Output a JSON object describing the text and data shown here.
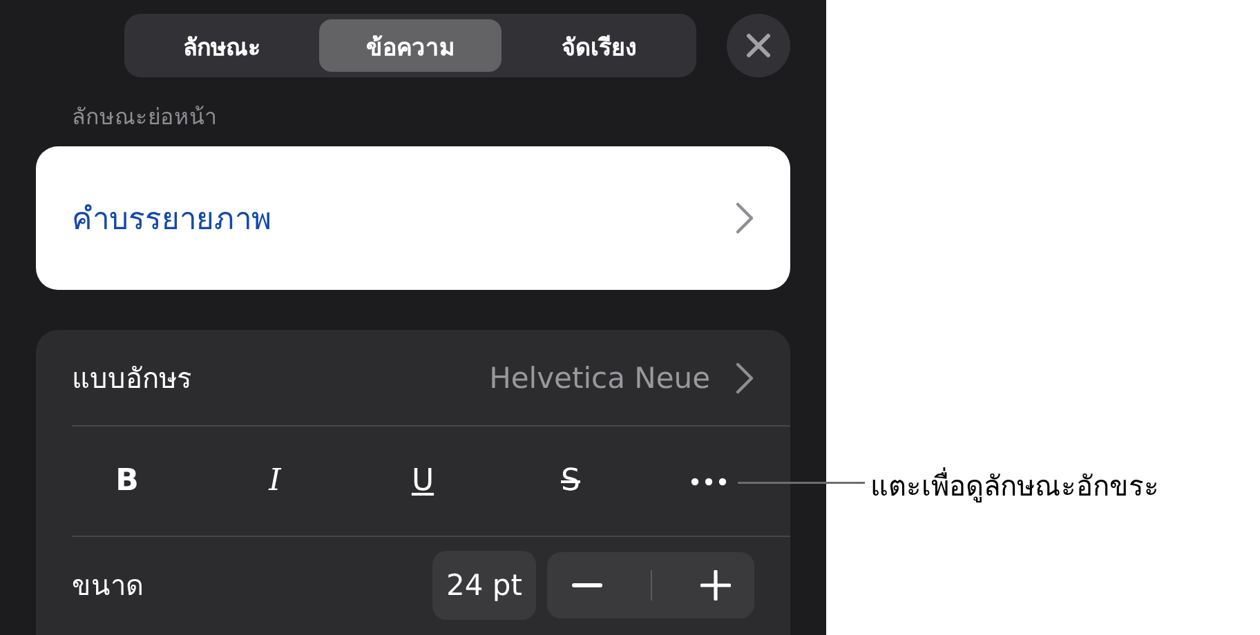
{
  "tabs": [
    {
      "label": "ลักษณะ",
      "selected": false
    },
    {
      "label": "ข้อความ",
      "selected": true
    },
    {
      "label": "จัดเรียง",
      "selected": false
    }
  ],
  "section_label": "ลักษณะย่อหน้า",
  "paragraph_style": {
    "value": "คำบรรยายภาพ"
  },
  "font": {
    "label": "แบบอักษร",
    "value": "Helvetica Neue"
  },
  "style_buttons": [
    {
      "kind": "bold",
      "label": "B"
    },
    {
      "kind": "italic",
      "label": "I"
    },
    {
      "kind": "underline",
      "label": "U"
    },
    {
      "kind": "strike",
      "label": "S"
    },
    {
      "kind": "more"
    }
  ],
  "size": {
    "label": "ขนาด",
    "value": "24 pt"
  },
  "callout": "แตะเพื่อดูลักษณะอักขระ"
}
